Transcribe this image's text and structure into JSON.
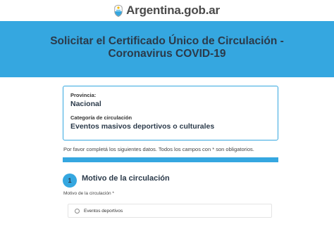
{
  "header": {
    "logo_icon": "argentina-shield-icon",
    "logo_text": "Argentina.gob.ar"
  },
  "hero": {
    "title_line1": "Solicitar el Certificado Único de Circulación -",
    "title_line2": "Coronavirus COVID-19",
    "color": "#35a7e0"
  },
  "summary": {
    "provincia_label": "Provincia:",
    "provincia_value": "Nacional",
    "categoria_label": "Categoría de circulación",
    "categoria_value": "Eventos masivos deportivos o culturales"
  },
  "form": {
    "instructions": "Por favor completá los siguientes datos. Todos los campos con * son obligatorios.",
    "step_number": "1",
    "step_title": "Motivo de la circulación",
    "field_label": "Motivo de la circulación *",
    "options": [
      {
        "label": "Eventos deportivos",
        "selected": false
      }
    ]
  }
}
